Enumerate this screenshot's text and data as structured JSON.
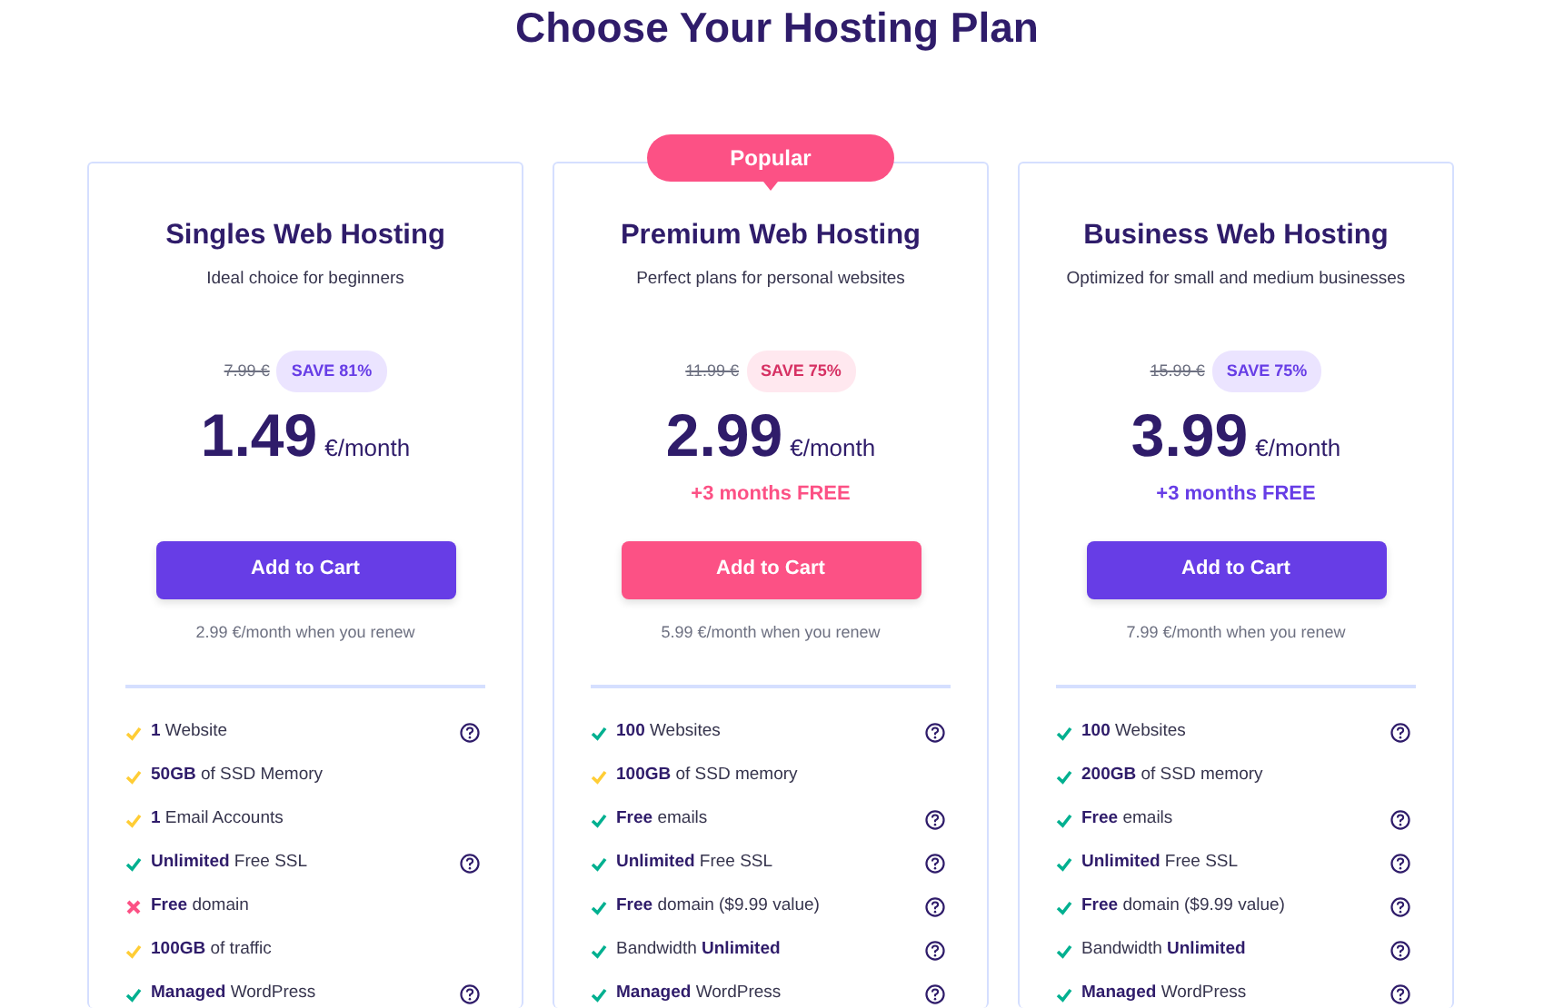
{
  "heading": "Choose Your Hosting Plan",
  "plans": [
    {
      "title": "Singles Web Hosting",
      "subtitle": "Ideal choice for beginners",
      "highlighted": false,
      "old_price": "7.99 €",
      "save": "SAVE 81%",
      "price": "1.49",
      "unit": "€/month",
      "button": "Add to Cart",
      "renew": "2.99 €/month when you renew",
      "features": [
        {
          "text": "**1** Website",
          "kind": "partial",
          "help": true
        },
        {
          "text": "**50GB** of SSD Memory",
          "kind": "partial",
          "help": false
        },
        {
          "text": "**1** Email Accounts",
          "kind": "partial",
          "help": false
        },
        {
          "text": "**Unlimited** Free SSL",
          "kind": "full",
          "help": true
        },
        {
          "text": "**Free** domain",
          "kind": "none",
          "help": false
        },
        {
          "text": "**100GB** of traffic",
          "kind": "partial",
          "help": false
        },
        {
          "text": "**Managed** WordPress",
          "kind": "full",
          "help": true
        }
      ]
    },
    {
      "title": "Premium Web Hosting",
      "subtitle": "Perfect plans for personal websites",
      "highlighted": true,
      "ribbon": "Popular",
      "old_price": "11.99 €",
      "save": "SAVE 75%",
      "price": "2.99",
      "unit": "€/month",
      "bonus": "+3 months FREE",
      "button": "Add to Cart",
      "renew": "5.99 €/month when you renew",
      "features": [
        {
          "text": "**100** Websites",
          "kind": "full",
          "help": true
        },
        {
          "text": "**100GB** of SSD memory",
          "kind": "partial",
          "help": false
        },
        {
          "text": "**Free** emails",
          "kind": "full",
          "help": true
        },
        {
          "text": "**Unlimited** Free SSL",
          "kind": "full",
          "help": true
        },
        {
          "text": "**Free** domain ($9.99 value)",
          "kind": "full",
          "help": true
        },
        {
          "text": "Bandwidth **Unlimited**",
          "kind": "full",
          "help": true
        },
        {
          "text": "**Managed** WordPress",
          "kind": "full",
          "help": true
        }
      ]
    },
    {
      "title": "Business Web Hosting",
      "subtitle": "Optimized for small and medium businesses",
      "highlighted": false,
      "old_price": "15.99 €",
      "save": "SAVE 75%",
      "price": "3.99",
      "unit": "€/month",
      "bonus": "+3 months FREE",
      "button": "Add to Cart",
      "renew": "7.99 €/month when you renew",
      "features": [
        {
          "text": "**100** Websites",
          "kind": "full",
          "help": true
        },
        {
          "text": "**200GB** of SSD memory",
          "kind": "full",
          "help": false
        },
        {
          "text": "**Free** emails",
          "kind": "full",
          "help": true
        },
        {
          "text": "**Unlimited** Free SSL",
          "kind": "full",
          "help": true
        },
        {
          "text": "**Free** domain ($9.99 value)",
          "kind": "full",
          "help": true
        },
        {
          "text": "Bandwidth **Unlimited**",
          "kind": "full",
          "help": true
        },
        {
          "text": "**Managed** WordPress",
          "kind": "full",
          "help": true
        }
      ]
    }
  ]
}
